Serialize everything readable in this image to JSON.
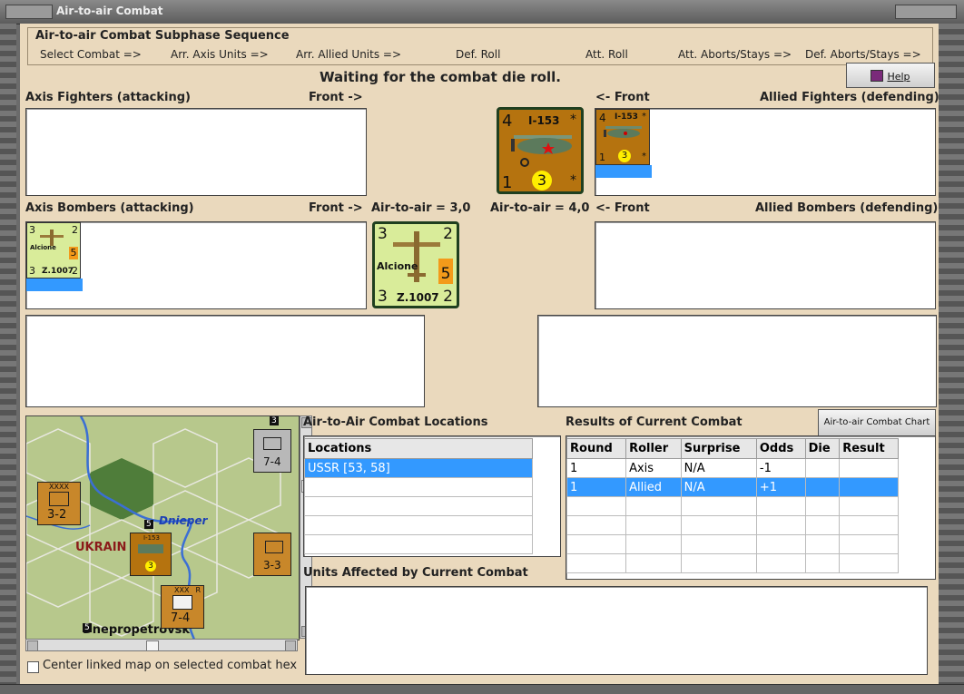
{
  "window": {
    "title": "Air-to-air Combat"
  },
  "subphase": {
    "title": "Air-to-air Combat Subphase Sequence",
    "steps": [
      "Select Combat =>",
      "Arr. Axis Units =>",
      "Arr. Allied Units =>",
      "Def. Roll",
      "Att. Roll",
      "Att. Aborts/Stays =>",
      "Def. Aborts/Stays =>"
    ]
  },
  "status_text": "Waiting for the combat die roll.",
  "help_button": "Help",
  "labels": {
    "axis_fighters": "Axis Fighters (attacking)",
    "front_right": "Front ->",
    "front_left": "<- Front",
    "allied_fighters": "Allied Fighters (defending)",
    "axis_bombers": "Axis Bombers (attacking)",
    "air_axis": "Air-to-air = 3,0",
    "air_allied": "Air-to-air = 4,0",
    "allied_bombers": "Allied Bombers (defending)",
    "locations_title": "Air-to-Air Combat Locations",
    "results_title": "Results of Current Combat",
    "units_affected": "Units Affected by Current Combat",
    "center_map": "Center linked map on selected combat hex"
  },
  "chart_button": "Air-to-air Combat Chart",
  "units": {
    "i153": {
      "name": "I-153",
      "top_left": "4",
      "bottom_left": "1",
      "center": "3",
      "star": "*",
      "color": "#b5730f"
    },
    "alcione": {
      "name": "Alcione",
      "model": "Z.1007",
      "top_left": "3",
      "top_right": "2",
      "bottom_left": "3",
      "bottom_right": "2",
      "range": "5",
      "color": "#d9ec9a"
    }
  },
  "locations": {
    "header": "Locations",
    "rows": [
      "USSR [53, 58]",
      "",
      "",
      "",
      ""
    ]
  },
  "results": {
    "headers": [
      "Round",
      "Roller",
      "Surprise",
      "Odds",
      "Die",
      "Result"
    ],
    "rows": [
      [
        "1",
        "Axis",
        "N/A",
        "-1",
        "",
        ""
      ],
      [
        "1",
        "Allied",
        "N/A",
        "+1",
        "",
        ""
      ],
      [
        "",
        "",
        "",
        "",
        "",
        ""
      ],
      [
        "",
        "",
        "",
        "",
        "",
        ""
      ],
      [
        "",
        "",
        "",
        "",
        "",
        ""
      ],
      [
        "",
        "",
        "",
        "",
        "",
        ""
      ]
    ]
  },
  "map": {
    "river": "Dnieper",
    "region": "UKRAIN",
    "city": "Dnepropetrovsk",
    "counters": [
      {
        "type": "XXXX",
        "value": "3-2"
      },
      {
        "type": "XXX",
        "value": "7-4",
        "mark": "R"
      },
      {
        "type": "XXX",
        "value": "3-3"
      },
      {
        "type": "XXX",
        "value": "7-4"
      },
      {
        "type": "I-153",
        "value": "3"
      }
    ],
    "stack_numbers": [
      "3",
      "5",
      "5"
    ]
  }
}
